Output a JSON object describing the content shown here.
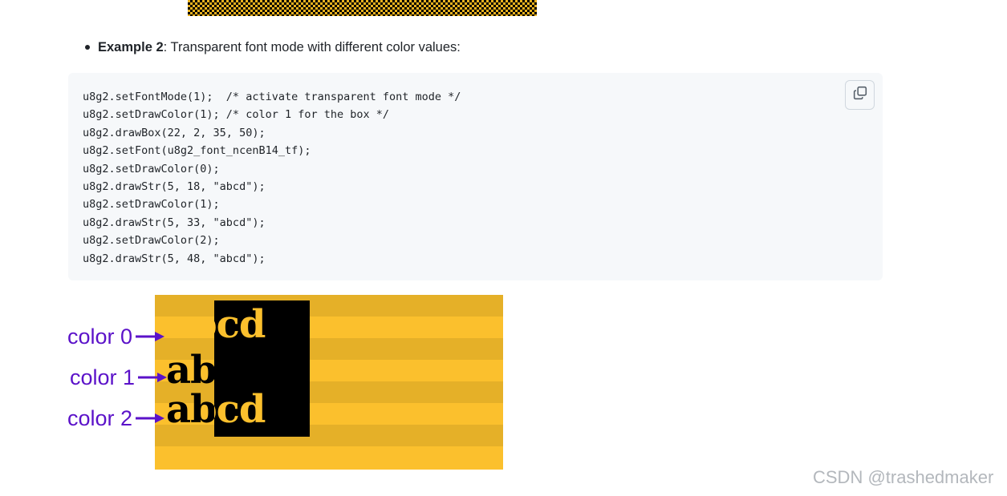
{
  "bullet": {
    "bold": "Example 2",
    "rest": ": Transparent font mode with different color values:"
  },
  "code": {
    "lines": [
      "u8g2.setFontMode(1);  /* activate transparent font mode */",
      "u8g2.setDrawColor(1); /* color 1 for the box */",
      "u8g2.drawBox(22, 2, 35, 50);",
      "u8g2.setFont(u8g2_font_ncenB14_tf);",
      "u8g2.setDrawColor(0);",
      "u8g2.drawStr(5, 18, \"abcd\");",
      "u8g2.setDrawColor(1);",
      "u8g2.drawStr(5, 33, \"abcd\");",
      "u8g2.setDrawColor(2);",
      "u8g2.drawStr(5, 48, \"abcd\");"
    ],
    "copy_icon": "copy-icon"
  },
  "illustration": {
    "demo_text": "abcd",
    "labels": [
      "color 0",
      "color 1",
      "color 2"
    ],
    "colors": {
      "background": "#fbc02d",
      "stripe": "#e5b028",
      "box": "#000000",
      "label": "#5b12c9"
    }
  },
  "watermark": "CSDN @trashedmaker"
}
